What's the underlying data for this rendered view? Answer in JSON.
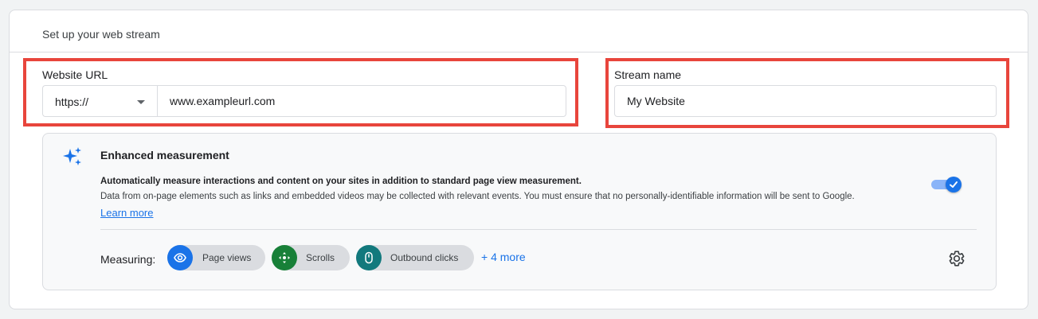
{
  "card": {
    "title": "Set up your web stream"
  },
  "website_url": {
    "label": "Website URL",
    "protocol": "https://",
    "value": "www.exampleurl.com"
  },
  "stream_name": {
    "label": "Stream name",
    "value": "My Website"
  },
  "enhanced_measurement": {
    "title": "Enhanced measurement",
    "description_bold": "Automatically measure interactions and content on your sites in addition to standard page view measurement.",
    "description": "Data from on-page elements such as links and embedded videos may be collected with relevant events. You must ensure that no personally-identifiable information will be sent to Google.",
    "learn_more": "Learn more",
    "toggle_on": true,
    "measuring_label": "Measuring:",
    "chips": [
      {
        "label": "Page views",
        "icon": "eye-icon",
        "color": "#1a73e8"
      },
      {
        "label": "Scrolls",
        "icon": "scroll-arrows-icon",
        "color": "#188038"
      },
      {
        "label": "Outbound clicks",
        "icon": "mouse-icon",
        "color": "#12797d"
      }
    ],
    "more": "+ 4 more"
  },
  "colors": {
    "highlight": "#e8453c",
    "accent": "#1a73e8"
  }
}
